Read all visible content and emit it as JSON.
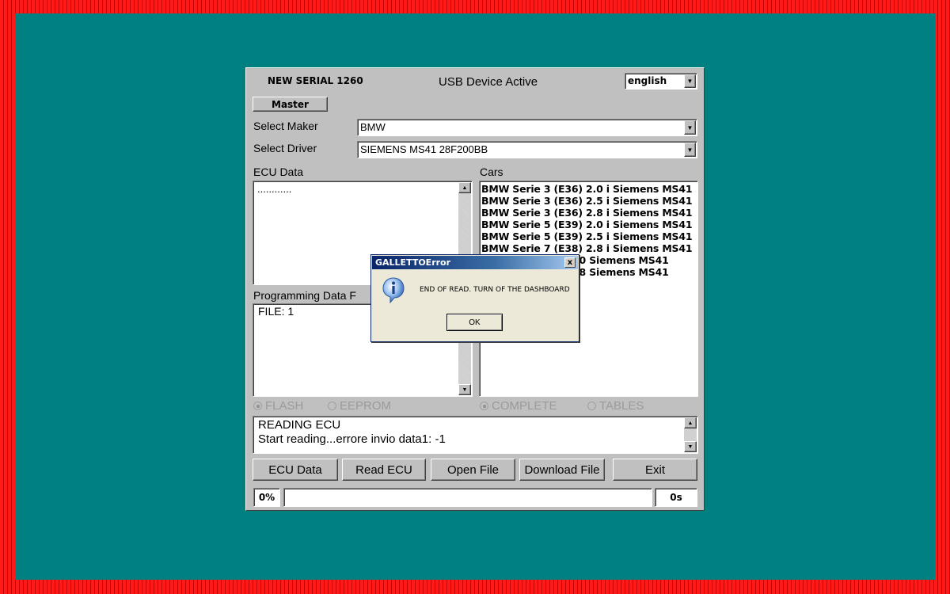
{
  "header": {
    "serial": "NEW SERIAL 1260",
    "status": "USB Device Active",
    "language": "english"
  },
  "master_label": "Master",
  "maker": {
    "label": "Select Maker",
    "value": "BMW"
  },
  "driver": {
    "label": "Select Driver",
    "value": "SIEMENS MS41 28F200BB"
  },
  "ecu_data": {
    "label": "ECU Data",
    "content": "............"
  },
  "programming": {
    "label": "Programming Data F",
    "content": "FILE: 1"
  },
  "cars": {
    "label": "Cars",
    "items": [
      "BMW Serie 3 (E36) 2.0 i Siemens MS41",
      "BMW Serie 3 (E36) 2.5 i Siemens MS41",
      "BMW Serie 3 (E36) 2.8 i Siemens MS41",
      "BMW Serie 5 (E39) 2.0 i Siemens MS41",
      "BMW Serie 5 (E39) 2.5 i Siemens MS41",
      "BMW Serie 7 (E38) 2.8 i Siemens MS41",
      ".0 Siemens MS41",
      ".8 Siemens MS41"
    ]
  },
  "radios": {
    "flash": "FLASH",
    "eeprom": "EEPROM",
    "complete": "COMPLETE",
    "tables": "TABLES"
  },
  "log": {
    "line1": "READING ECU",
    "line2": "Start reading...errore invio data1: -1"
  },
  "buttons": {
    "ecu_data": "ECU Data",
    "read_ecu": "Read ECU",
    "open_file": "Open File",
    "download_file": "Download File",
    "exit": "Exit"
  },
  "progress": {
    "percent_label": "0%",
    "time_label": "0s",
    "fraction": 0
  },
  "dialog": {
    "title": "GALLETTOError",
    "message": "END OF READ. TURN OF THE DASHBOARD",
    "ok": "OK",
    "close": "x"
  },
  "colors": {
    "desktop": "#008080",
    "frame": "#ee1111",
    "window": "#c0c0c0",
    "dialog": "#ece9d8"
  }
}
